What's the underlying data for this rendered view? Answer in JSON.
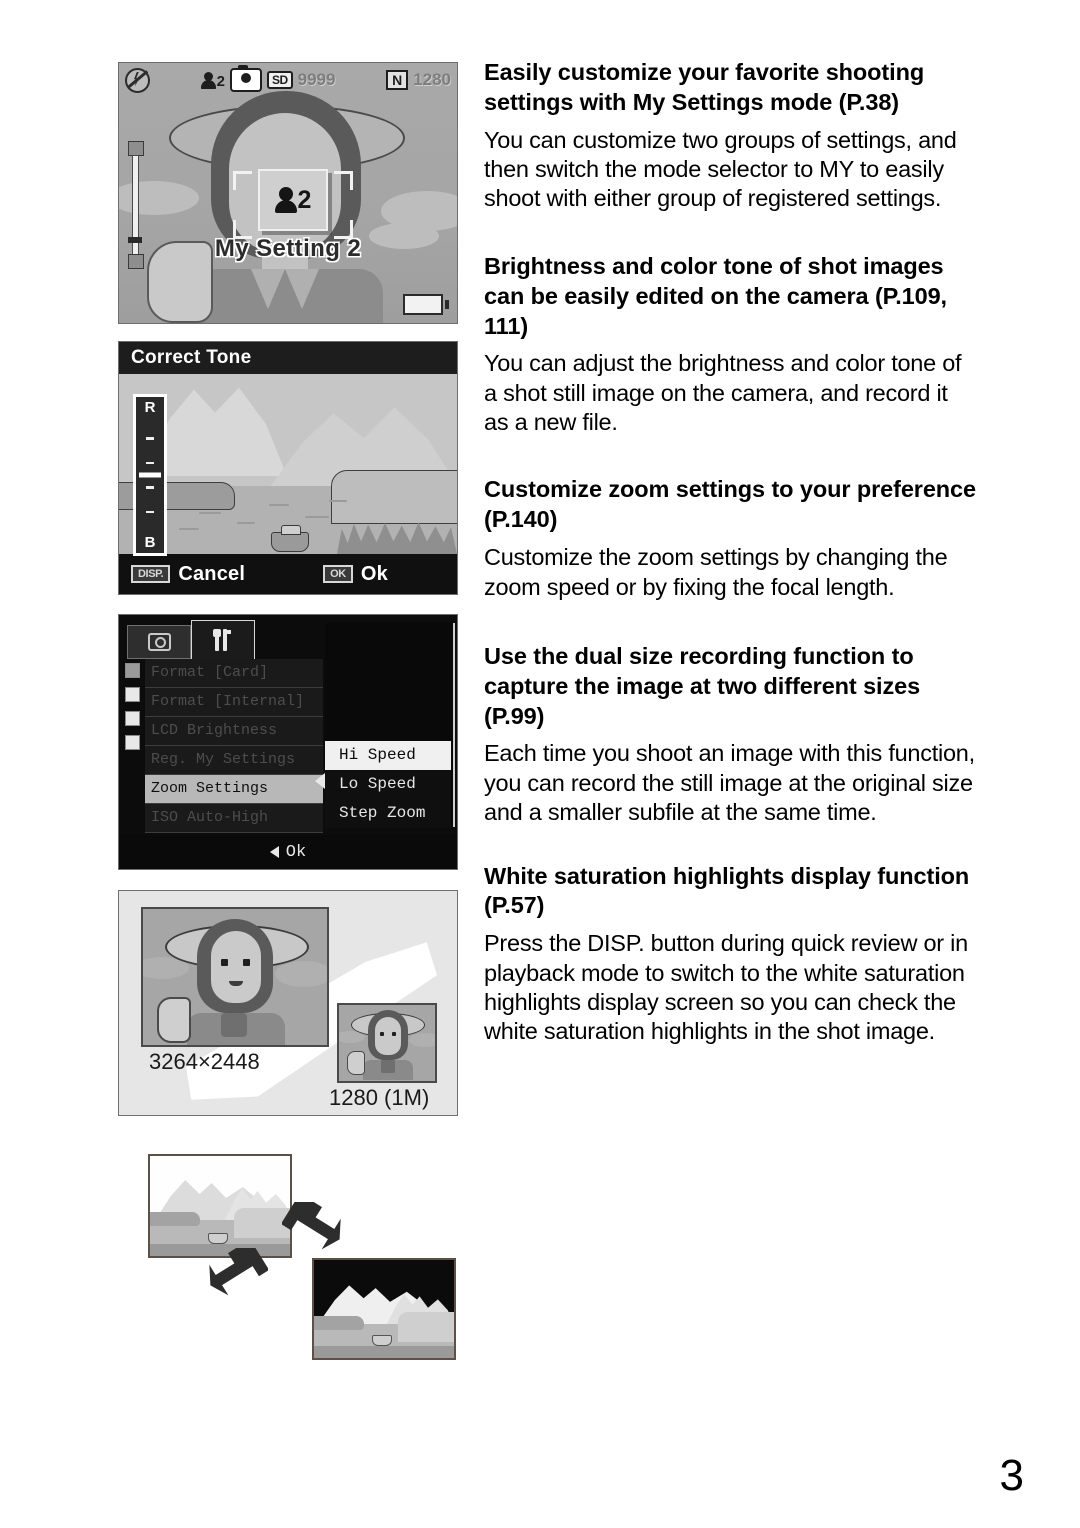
{
  "page": {
    "number": "3"
  },
  "features": [
    {
      "id": "my-settings",
      "heading": "Easily customize your favorite shooting settings with My Settings mode (P.38)",
      "body": "You can customize two groups of settings, and then switch the mode selector to MY to easily shoot with either group of registered settings."
    },
    {
      "id": "correct-tone",
      "heading": "Brightness and color tone of shot images can be easily edited on the camera (P.109, 111)",
      "body": "You can adjust the brightness and color tone of a shot still image on the camera, and record it as a new file."
    },
    {
      "id": "zoom-settings",
      "heading": "Customize zoom settings to your preference (P.140)",
      "body": "Customize the zoom settings by changing the zoom speed or by fixing the focal length."
    },
    {
      "id": "dual-size",
      "heading": "Use the dual size recording function to capture the image at two different sizes (P.99)",
      "body": "Each time you shoot an image with this function, you can record the still image at the original size and a smaller subfile at the same time."
    },
    {
      "id": "white-saturation",
      "heading": "White saturation highlights display function (P.57)",
      "body": "Press the DISP. button during quick review or in playback mode to switch to the white saturation highlights display screen so you can check the white saturation highlights in the shot image."
    }
  ],
  "lcd_live_view": {
    "status_bar": {
      "flash_icon": "flash-off-icon",
      "my_settings_icon": "my-settings-2-icon",
      "my_settings_number": "2",
      "camera_icon": "camera-icon",
      "card_label": "SD",
      "remaining_shots": "9999",
      "quality_label": "N",
      "image_size": "1280"
    },
    "overlay_badge_number": "2",
    "overlay_label": "My Setting 2",
    "zoom_bar_icon": "zoom-bar-icon",
    "battery_icon": "battery-icon"
  },
  "correct_tone_screen": {
    "title": "Correct Tone",
    "slider_top_label": "R",
    "slider_bottom_label": "B",
    "cancel_key": "DISP.",
    "cancel_label": "Cancel",
    "ok_key": "OK",
    "ok_label": "Ok"
  },
  "zoom_settings_screen": {
    "tabs": [
      {
        "id": "shooting",
        "icon": "camera-tab-icon",
        "active": false
      },
      {
        "id": "setup",
        "icon": "tools-tab-icon",
        "active": true
      }
    ],
    "menu_items": [
      {
        "label": "Format [Card]",
        "selected": false
      },
      {
        "label": "Format [Internal]",
        "selected": false
      },
      {
        "label": "LCD Brightness",
        "selected": false
      },
      {
        "label": "Reg. My Settings",
        "selected": false
      },
      {
        "label": "Zoom Settings",
        "selected": true
      },
      {
        "label": "ISO Auto-High",
        "selected": false
      }
    ],
    "submenu_options": [
      {
        "label": "Hi Speed",
        "highlighted": true
      },
      {
        "label": "Lo Speed",
        "highlighted": false
      },
      {
        "label": "Step Zoom",
        "highlighted": false
      }
    ],
    "bottom_hint": "Ok"
  },
  "dual_size_figure": {
    "large_caption": "3264×2448",
    "small_caption": "1280 (1M)"
  },
  "white_saturation_figure": {
    "normal_image": "landscape-normal-thumbnail",
    "highlight_image": "landscape-white-saturation-thumbnail",
    "arrow_down_icon": "arrow-down-right-icon",
    "arrow_up_icon": "arrow-up-left-icon"
  }
}
